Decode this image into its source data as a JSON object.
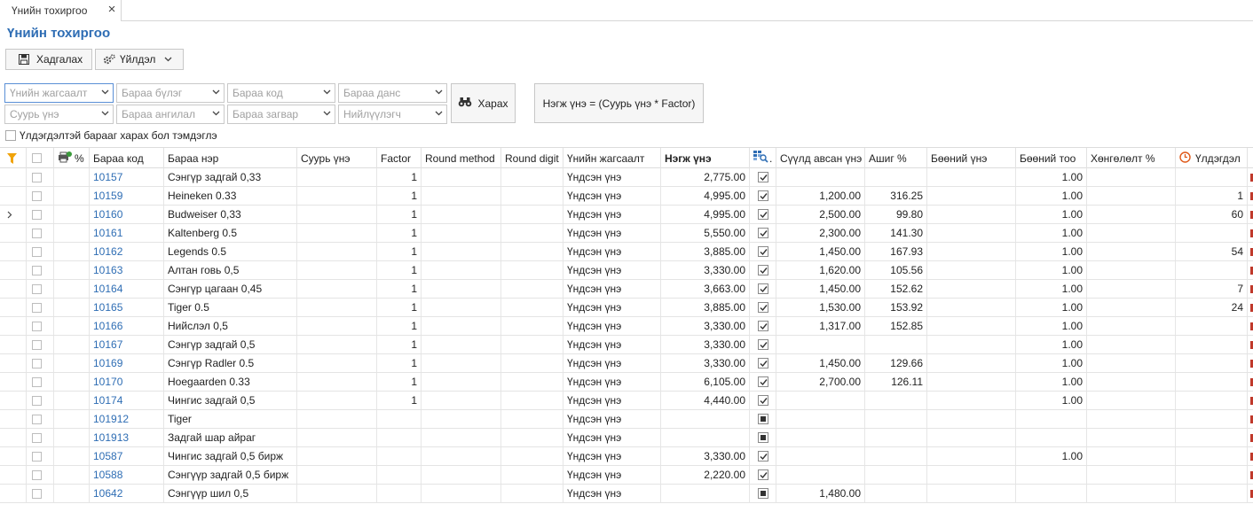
{
  "tab": {
    "label": "Үнийн тохиргоо"
  },
  "page_title": "Үнийн тохиргоо",
  "toolbar": {
    "save_label": "Хадгалах",
    "action_label": "Үйлдэл"
  },
  "filters": {
    "price_list": "Үнийн жагсаалт",
    "item_group": "Бараа бүлэг",
    "item_code": "Бараа код",
    "item_account": "Бараа данс",
    "base_price": "Суурь үнэ",
    "item_class": "Бараа ангилал",
    "item_model": "Бараа загвар",
    "supplier": "Нийлүүлэгч"
  },
  "view_button": "Харах",
  "formula": "Нэгж үнэ = (Суурь үнэ * Factor)",
  "show_stock_label": "Үлдэгдэлтэй барааг харах бол тэмдэглэ",
  "columns": {
    "percent": "%",
    "code": "Бараа код",
    "name": "Бараа нэр",
    "base_price": "Суурь үнэ",
    "factor": "Factor",
    "round_method": "Round method",
    "round_digit": "Round digit",
    "price_list": "Үнийн жагсаалт",
    "unit_price": "Нэгж үнэ",
    "flag_suffix": ".",
    "last_purchase": "Сүүлд авсан үнэ",
    "profit": "Ашиг %",
    "wholesale_price": "Бөөний үнэ",
    "wholesale_qty": "Бөөний тоо",
    "discount": "Хөнгөлөлт %",
    "stock": "Үлдэгдэл"
  },
  "rows": [
    {
      "code": "10157",
      "name": "Сэнгүр задгай 0,33",
      "factor": "1",
      "price_list": "Үндсэн үнэ",
      "unit_price": "2,775.00",
      "flag": "on",
      "last_purchase": "",
      "profit": "",
      "wholesale_qty": "1.00",
      "stock": "",
      "marker": false
    },
    {
      "code": "10159",
      "name": "Heineken 0.33",
      "factor": "1",
      "price_list": "Үндсэн үнэ",
      "unit_price": "4,995.00",
      "flag": "on",
      "last_purchase": "1,200.00",
      "profit": "316.25",
      "wholesale_qty": "1.00",
      "stock": "1",
      "marker": false
    },
    {
      "code": "10160",
      "name": "Budweiser 0,33",
      "factor": "1",
      "price_list": "Үндсэн үнэ",
      "unit_price": "4,995.00",
      "flag": "on",
      "last_purchase": "2,500.00",
      "profit": "99.80",
      "wholesale_qty": "1.00",
      "stock": "60",
      "marker": true
    },
    {
      "code": "10161",
      "name": "Kaltenberg 0.5",
      "factor": "1",
      "price_list": "Үндсэн үнэ",
      "unit_price": "5,550.00",
      "flag": "on",
      "last_purchase": "2,300.00",
      "profit": "141.30",
      "wholesale_qty": "1.00",
      "stock": "",
      "marker": false
    },
    {
      "code": "10162",
      "name": "Legends 0.5",
      "factor": "1",
      "price_list": "Үндсэн үнэ",
      "unit_price": "3,885.00",
      "flag": "on",
      "last_purchase": "1,450.00",
      "profit": "167.93",
      "wholesale_qty": "1.00",
      "stock": "54",
      "marker": false
    },
    {
      "code": "10163",
      "name": "Алтан говь 0,5",
      "factor": "1",
      "price_list": "Үндсэн үнэ",
      "unit_price": "3,330.00",
      "flag": "on",
      "last_purchase": "1,620.00",
      "profit": "105.56",
      "wholesale_qty": "1.00",
      "stock": "",
      "marker": false
    },
    {
      "code": "10164",
      "name": "Сэнгүр цагаан 0,45",
      "factor": "1",
      "price_list": "Үндсэн үнэ",
      "unit_price": "3,663.00",
      "flag": "on",
      "last_purchase": "1,450.00",
      "profit": "152.62",
      "wholesale_qty": "1.00",
      "stock": "7",
      "marker": false
    },
    {
      "code": "10165",
      "name": "Tiger 0.5",
      "factor": "1",
      "price_list": "Үндсэн үнэ",
      "unit_price": "3,885.00",
      "flag": "on",
      "last_purchase": "1,530.00",
      "profit": "153.92",
      "wholesale_qty": "1.00",
      "stock": "24",
      "marker": false
    },
    {
      "code": "10166",
      "name": "Нийслэл 0,5",
      "factor": "1",
      "price_list": "Үндсэн үнэ",
      "unit_price": "3,330.00",
      "flag": "on",
      "last_purchase": "1,317.00",
      "profit": "152.85",
      "wholesale_qty": "1.00",
      "stock": "",
      "marker": false
    },
    {
      "code": "10167",
      "name": "Сэнгүр задгай 0,5",
      "factor": "1",
      "price_list": "Үндсэн үнэ",
      "unit_price": "3,330.00",
      "flag": "on",
      "last_purchase": "",
      "profit": "",
      "wholesale_qty": "1.00",
      "stock": "",
      "marker": false
    },
    {
      "code": "10169",
      "name": "Сэнгүр Radler 0.5",
      "factor": "1",
      "price_list": "Үндсэн үнэ",
      "unit_price": "3,330.00",
      "flag": "on",
      "last_purchase": "1,450.00",
      "profit": "129.66",
      "wholesale_qty": "1.00",
      "stock": "",
      "marker": false
    },
    {
      "code": "10170",
      "name": "Hoegaarden 0.33",
      "factor": "1",
      "price_list": "Үндсэн үнэ",
      "unit_price": "6,105.00",
      "flag": "on",
      "last_purchase": "2,700.00",
      "profit": "126.11",
      "wholesale_qty": "1.00",
      "stock": "",
      "marker": false
    },
    {
      "code": "10174",
      "name": "Чингис задгай 0,5",
      "factor": "1",
      "price_list": "Үндсэн үнэ",
      "unit_price": "4,440.00",
      "flag": "on",
      "last_purchase": "",
      "profit": "",
      "wholesale_qty": "1.00",
      "stock": "",
      "marker": false
    },
    {
      "code": "101912",
      "name": "Tiger",
      "factor": "",
      "price_list": "Үндсэн үнэ",
      "unit_price": "",
      "flag": "ind",
      "last_purchase": "",
      "profit": "",
      "wholesale_qty": "",
      "stock": "",
      "marker": false
    },
    {
      "code": "101913",
      "name": "Задгай шар айраг",
      "factor": "",
      "price_list": "Үндсэн үнэ",
      "unit_price": "",
      "flag": "ind",
      "last_purchase": "",
      "profit": "",
      "wholesale_qty": "",
      "stock": "",
      "marker": false
    },
    {
      "code": "10587",
      "name": "Чингис задгай 0,5 бирж",
      "factor": "",
      "price_list": "Үндсэн үнэ",
      "unit_price": "3,330.00",
      "flag": "on",
      "last_purchase": "",
      "profit": "",
      "wholesale_qty": "1.00",
      "stock": "",
      "marker": false
    },
    {
      "code": "10588",
      "name": "Сэнгүүр задгай 0,5 бирж",
      "factor": "",
      "price_list": "Үндсэн үнэ",
      "unit_price": "2,220.00",
      "flag": "on",
      "last_purchase": "",
      "profit": "",
      "wholesale_qty": "",
      "stock": "",
      "marker": false
    },
    {
      "code": "10642",
      "name": "Сэнгүүр шил 0,5",
      "factor": "",
      "price_list": "Үндсэн үнэ",
      "unit_price": "",
      "flag": "ind",
      "last_purchase": "1,480.00",
      "profit": "",
      "wholesale_qty": "",
      "stock": "",
      "marker": false
    }
  ]
}
